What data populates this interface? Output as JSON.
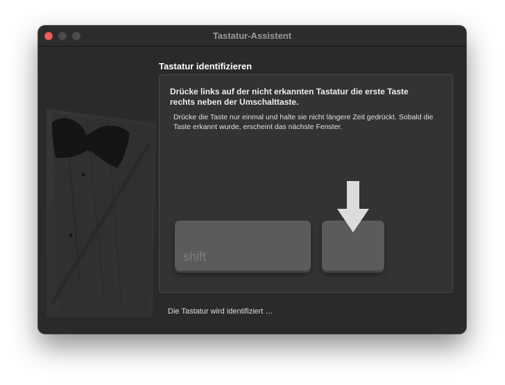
{
  "window": {
    "title": "Tastatur-Assistent"
  },
  "step": {
    "heading": "Tastatur identifizieren",
    "instruction": "Drücke links auf der nicht erkannten Tastatur die erste Taste rechts neben der Umschalttaste.",
    "detail": "Drücke die Taste nur einmal und halte sie nicht längere Zeit gedrückt. Sobald die Taste erkannt wurde, erscheint das nächste Fenster."
  },
  "keys": {
    "shift_label": "shift"
  },
  "status": "Die Tastatur wird identifiziert …"
}
